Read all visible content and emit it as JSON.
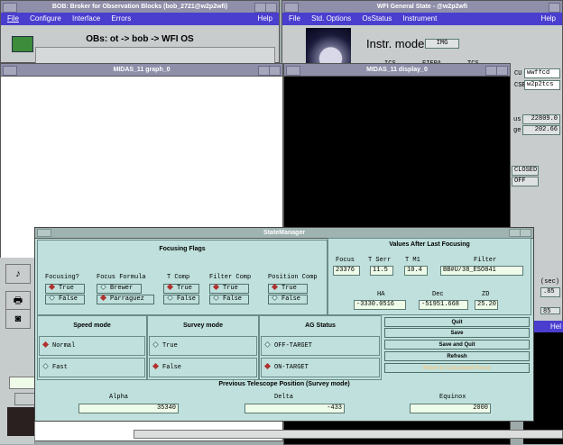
{
  "bob": {
    "title": "BOB: Broker for Observation Blocks (bob_2721@w2p2wfi)",
    "menu": [
      "File",
      "Configure",
      "Interface",
      "Errors"
    ],
    "help": "Help",
    "obs_label": "OBs: ot -> bob -> WFI OS"
  },
  "wfi": {
    "title": "WFI General State - @w2p2wfi",
    "menu": [
      "File",
      "Std. Options",
      "OsStatus",
      "Instrument"
    ],
    "help": "Help",
    "instr_mode_label": "Instr. mode",
    "instr_mode_value": "IMG",
    "col_labels": [
      "ICS",
      "FIERA",
      "TCS"
    ],
    "right_labels": [
      "CU",
      "CSE"
    ],
    "right_values": [
      "wwffcd",
      "w2p2tcs"
    ],
    "exp_labels": [
      "us",
      "ge"
    ],
    "exp_values": [
      "22809.0",
      "202.66"
    ],
    "status_values": [
      "CLOSED",
      "OFF"
    ],
    "side_text": [
      "(sec)",
      ".85",
      "85"
    ],
    "help_short": "Hel"
  },
  "graph": {
    "title": "MIDAS_11 graph_0"
  },
  "display": {
    "title": "MIDAS_11 display_0"
  },
  "sm": {
    "title": "StateManager",
    "focusing_flags": "Focusing Flags",
    "flag_cols": [
      {
        "label": "Focusing?",
        "options": [
          {
            "text": "True",
            "on": true
          },
          {
            "text": "False",
            "on": false
          }
        ]
      },
      {
        "label": "Focus Formula",
        "options": [
          {
            "text": "Brewer",
            "on": false
          },
          {
            "text": "Parraguez",
            "on": true
          }
        ]
      },
      {
        "label": "T Comp",
        "options": [
          {
            "text": "True",
            "on": true
          },
          {
            "text": "False",
            "on": false
          }
        ]
      },
      {
        "label": "Filter Comp",
        "options": [
          {
            "text": "True",
            "on": true
          },
          {
            "text": "False",
            "on": false
          }
        ]
      },
      {
        "label": "Position Comp",
        "options": [
          {
            "text": "True",
            "on": true
          },
          {
            "text": "False",
            "on": false
          }
        ]
      }
    ],
    "values_title": "Values After Last Focusing",
    "values_labels": [
      "Focus",
      "T Serr",
      "T M1",
      "Filter"
    ],
    "values": [
      "23376",
      "11.5",
      "10.4",
      "BB#U/38_ESO841"
    ],
    "ha_label": "HA",
    "dec_label": "Dec",
    "zd_label": "ZD",
    "ha": "-3330.0516",
    "dec": "-51951.668",
    "zd": "25.20",
    "speed_mode": "Speed mode",
    "survey_mode": "Survey mode",
    "ag_status": "AG Status",
    "speed_opts": [
      {
        "text": "Normal",
        "on": true
      },
      {
        "text": "Fast",
        "on": false
      }
    ],
    "survey_opts": [
      {
        "text": "True",
        "on": false
      },
      {
        "text": "False",
        "on": true
      }
    ],
    "ag_opts": [
      {
        "text": "OFF-TARGET",
        "on": false
      },
      {
        "text": "ON-TARGET",
        "on": true
      }
    ],
    "buttons": [
      "Quit",
      "Save",
      "Save and Quit",
      "Refresh",
      "Reset to Calculated Focus"
    ],
    "prev_pos": "Previous Telescope Position (Survey mode)",
    "alpha_label": "Alpha",
    "delta_label": "Delta",
    "equinox_label": "Equinox",
    "alpha": "35340",
    "delta": "-433",
    "equinox": "2000"
  },
  "colors": {
    "titlebar": "#8f8faa",
    "menubar": "#4a3ecf",
    "panel": "#bfe0dc",
    "field": "#eefbe8",
    "selected": "#b0312f",
    "disabled_text": "#f2c98a"
  }
}
